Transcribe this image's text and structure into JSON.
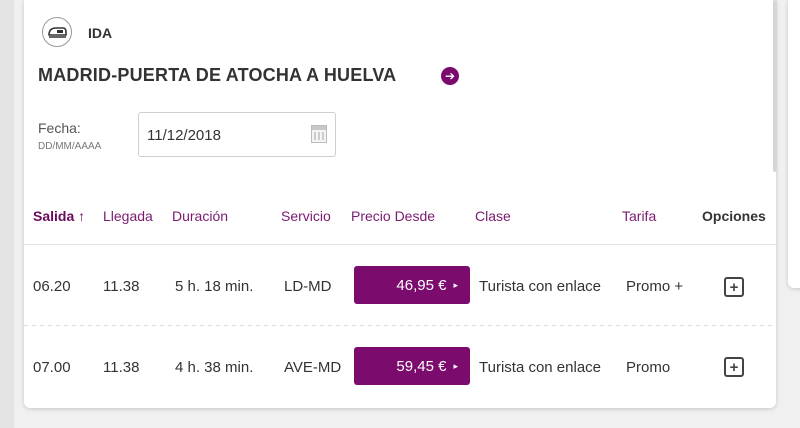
{
  "header": {
    "direction_label": "IDA",
    "direction_icon": "train-icon",
    "route_title": "MADRID-PUERTA DE ATOCHA A HUELVA",
    "route_arrow": "➔"
  },
  "date_field": {
    "label": "Fecha:",
    "format": "DD/MM/AAAA",
    "value": "11/12/2018",
    "icon": "calendar-icon"
  },
  "table": {
    "headers": {
      "salida": "Salida ↑",
      "llegada": "Llegada",
      "duracion": "Duración",
      "servicio": "Servicio",
      "precio": "Precio Desde",
      "clase": "Clase",
      "tarifa": "Tarifa",
      "opciones": "Opciones"
    },
    "rows": [
      {
        "salida": "06.20",
        "llegada": "11.38",
        "duracion": "5 h. 18 min.",
        "servicio": "LD-MD",
        "precio": "46,95 €",
        "clase": "Turista con enlace",
        "tarifa": "Promo +",
        "opcion": "+"
      },
      {
        "salida": "07.00",
        "llegada": "11.38",
        "duracion": "4 h. 38 min.",
        "servicio": "AVE-MD",
        "precio": "59,45 €",
        "clase": "Turista con enlace",
        "tarifa": "Promo",
        "opcion": "+"
      }
    ],
    "price_arrow": "▸"
  },
  "colors": {
    "accent": "#7b0b6d",
    "header_text": "#7a1a70"
  }
}
